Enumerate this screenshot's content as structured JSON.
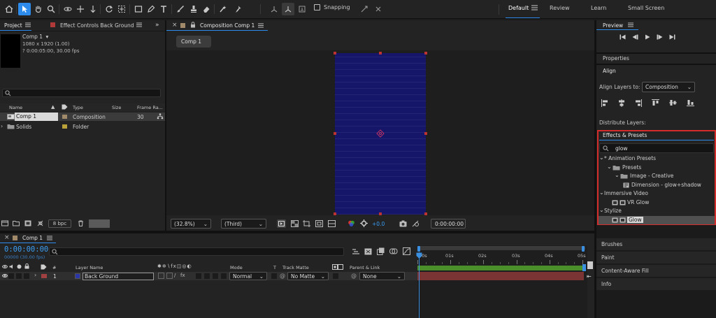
{
  "workspace": {
    "items": [
      "Default",
      "Review",
      "Learn",
      "Small Screen"
    ],
    "snapping_label": "Snapping"
  },
  "project": {
    "tab_label": "Project",
    "effect_controls_tab": "Effect Controls Back Ground",
    "comp_name": "Comp 1",
    "comp_dims": "1080 x 1920 (1.00)",
    "comp_duration": "? 0:00:05:00, 30.00 fps",
    "columns": {
      "name": "Name",
      "type": "Type",
      "size": "Size",
      "frame_rate": "Frame Ra..."
    },
    "items": [
      {
        "name": "Comp 1",
        "type": "Composition",
        "size": "",
        "fps": "30",
        "label_color": "#a08a6a"
      },
      {
        "name": "Solids",
        "type": "Folder",
        "size": "",
        "fps": "",
        "label_color": "#b9a23a"
      }
    ],
    "bpc": "8 bpc"
  },
  "composition": {
    "tab_label": "Composition Comp 1",
    "breadcrumb": "Comp 1",
    "zoom": "(32.8%)",
    "resolution": "(Third)",
    "exposure": "+0.0",
    "timecode": "0:00:00:00",
    "canvas_color": "#15166a"
  },
  "timeline": {
    "tab_label": "Comp 1",
    "current_time": "0:00:00:00",
    "fps_readout": "00000 (30.00 fps)",
    "columns": {
      "num": "#",
      "layer_name": "Layer Name",
      "mode": "Mode",
      "t": "T",
      "track_matte": "Track Matte",
      "parent": "Parent & Link"
    },
    "ruler_ticks": [
      "00s",
      "01s",
      "02s",
      "03s",
      "04s",
      "05s"
    ],
    "layer": {
      "index": "1",
      "name": "Back Ground",
      "mode": "Normal",
      "matte": "No Matte",
      "parent": "None",
      "label_color": "#a04040"
    }
  },
  "preview": {
    "title": "Preview"
  },
  "properties": {
    "title": "Properties"
  },
  "align": {
    "title": "Align",
    "align_to_label": "Align Layers to:",
    "align_to_value": "Composition",
    "distribute_label": "Distribute Layers:"
  },
  "effects": {
    "title": "Effects & Presets",
    "search_value": "glow",
    "tree": [
      {
        "label": "* Animation Presets",
        "depth": 0,
        "kind": "category"
      },
      {
        "label": "Presets",
        "depth": 1,
        "kind": "folder"
      },
      {
        "label": "Image - Creative",
        "depth": 2,
        "kind": "folder"
      },
      {
        "label": "Dimension - glow+shadow",
        "depth": 3,
        "kind": "preset"
      },
      {
        "label": "Immersive Video",
        "depth": 0,
        "kind": "category"
      },
      {
        "label": "VR Glow",
        "depth": 1,
        "kind": "effect"
      },
      {
        "label": "Stylize",
        "depth": 0,
        "kind": "category"
      },
      {
        "label": "Glow",
        "depth": 1,
        "kind": "effect",
        "selected": true
      }
    ],
    "highlight_color": "#d42b2b"
  },
  "right_panels": [
    "Brushes",
    "Paint",
    "Content-Aware Fill",
    "Info"
  ]
}
